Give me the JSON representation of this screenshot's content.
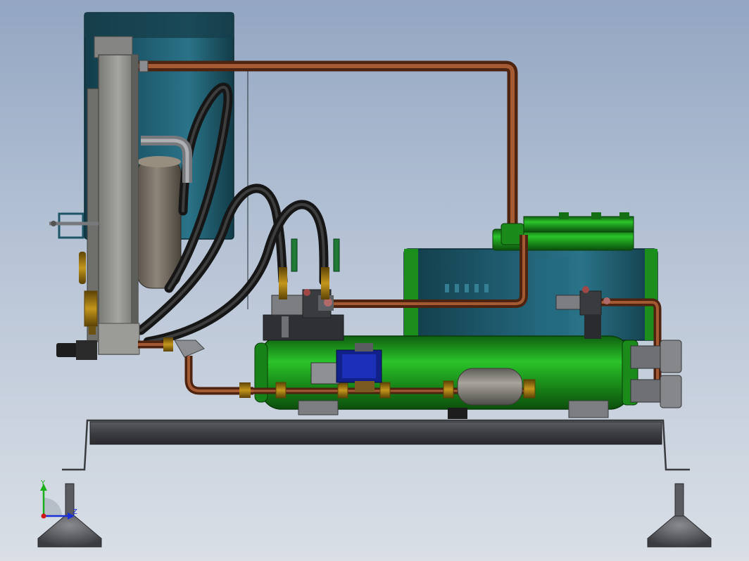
{
  "view": {
    "background_top": "#93a6c2",
    "background_bottom": "#dadfe6"
  },
  "model": {
    "colors": {
      "frame_steel": "#3d3e42",
      "copper": "#7a3a1e",
      "shell_green": "#1f9a1f",
      "tank_teal": "#1d5566",
      "hose_black": "#1c1c1c",
      "brass": "#9a7410",
      "solenoid_blue": "#12208a",
      "valve_handle_green": "#1e7a34",
      "filter_grey": "#7c7a74"
    },
    "components": [
      "condenser-plate",
      "receiver-tank",
      "discharge-line",
      "suction-hoses",
      "compressor",
      "shell-heat-exchanger",
      "filter-drier",
      "solenoid-valve",
      "base-frame",
      "leveling-feet"
    ]
  },
  "triad": {
    "y_label": "Y",
    "z_label": "Z",
    "y_color": "#1bb01b",
    "z_color": "#1a2fd6",
    "origin_color": "#d01818"
  }
}
